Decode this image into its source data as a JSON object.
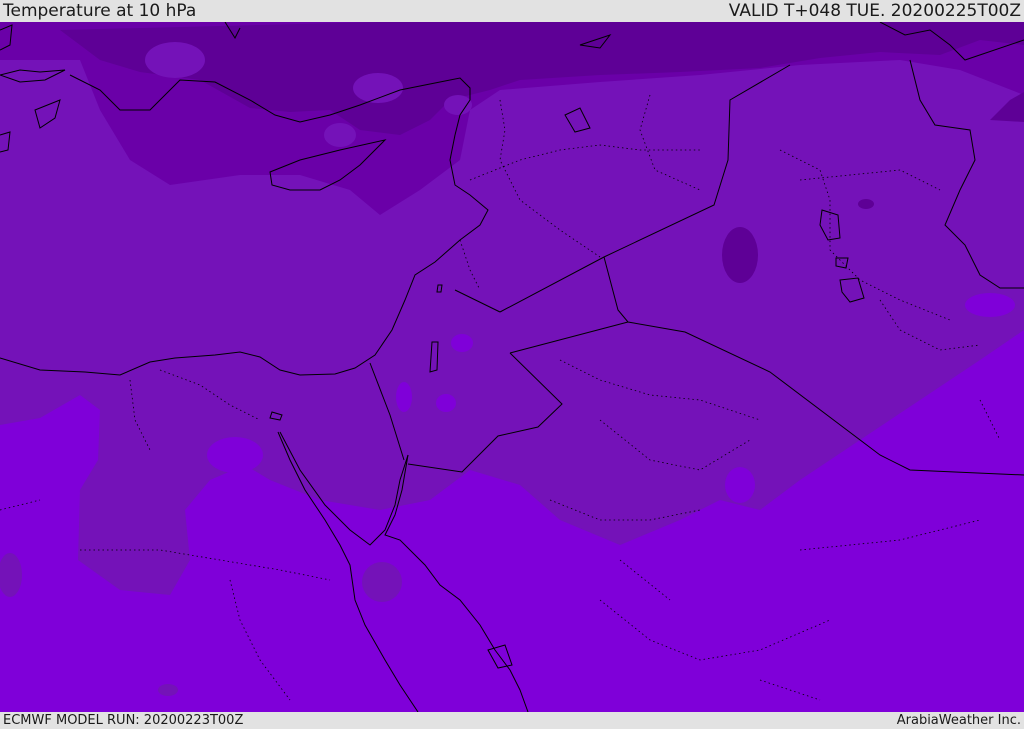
{
  "header": {
    "title": "Temperature at 10 hPa",
    "valid_time": "VALID T+048 TUE. 20200225T00Z"
  },
  "footer": {
    "model_run": "ECMWF MODEL RUN: 20200223T00Z",
    "credit": "ArabiaWeather Inc."
  },
  "colors": {
    "band_coldest": "#5e0096",
    "band_cold": "#6a00a8",
    "band_mid": "#7412b8",
    "band_warm": "#7f00d9",
    "borders": "#000000"
  }
}
